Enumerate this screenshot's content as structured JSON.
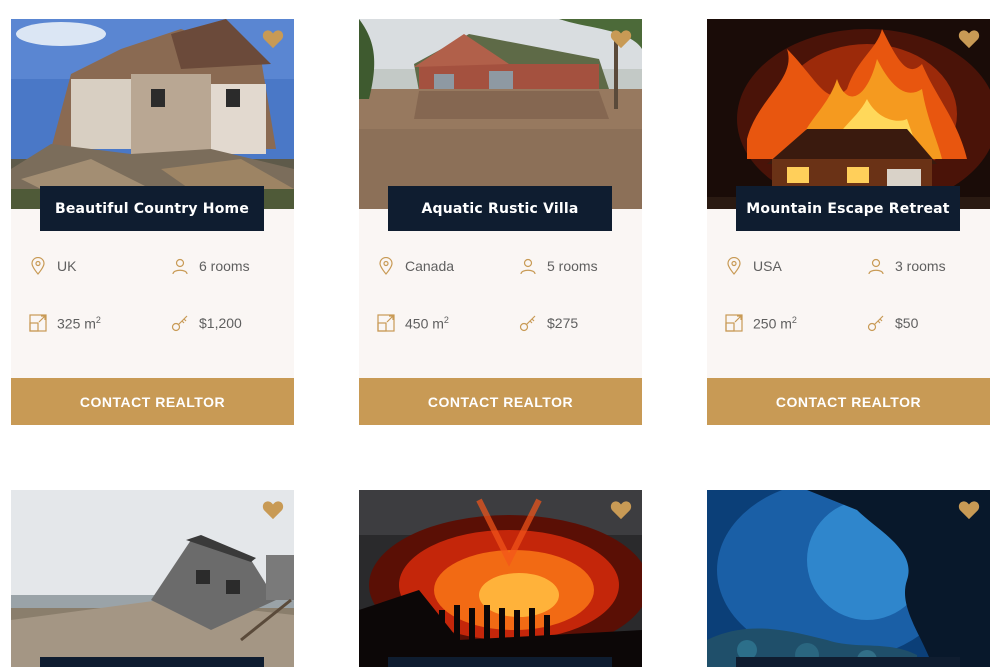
{
  "colors": {
    "accent": "#c89a55",
    "title_bg": "#0f1d30",
    "card_bg": "#faf6f4",
    "text": "#5f5f5f"
  },
  "listings": [
    {
      "title": "Beautiful Country Home",
      "location": "UK",
      "rooms": "6 rooms",
      "area": "325 m",
      "area_unit_sup": "2",
      "price": "$1,200",
      "cta": "CONTACT REALTOR",
      "favorite_icon": "heart-icon"
    },
    {
      "title": "Aquatic Rustic Villa",
      "location": "Canada",
      "rooms": "5 rooms",
      "area": "450 m",
      "area_unit_sup": "2",
      "price": "$275",
      "cta": "CONTACT REALTOR",
      "favorite_icon": "heart-icon"
    },
    {
      "title": "Mountain Escape Retreat",
      "location": "USA",
      "rooms": "3 rooms",
      "area": "250 m",
      "area_unit_sup": "2",
      "price": "$50",
      "cta": "CONTACT REALTOR",
      "favorite_icon": "heart-icon"
    }
  ],
  "icons": {
    "location": "map-pin-icon",
    "rooms": "person-icon",
    "area": "area-icon",
    "price": "key-icon"
  }
}
